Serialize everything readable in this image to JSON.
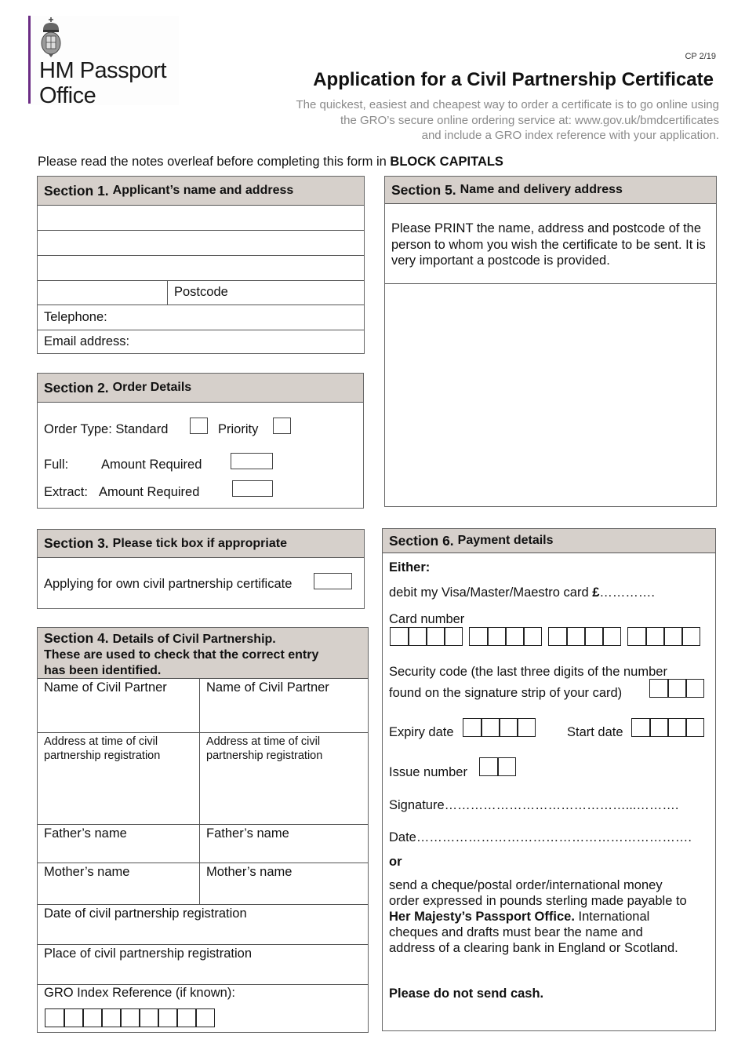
{
  "header": {
    "logo": {
      "line1": "HM Passport",
      "line2": "Office",
      "crest_icon": "royal-crest-icon",
      "brand_color": "#6b2c84"
    },
    "form_code": "CP 2/19",
    "title": "Application for a Civil Partnership Certificate",
    "intro": [
      "The quickest, easiest and cheapest way to order a certificate is to go online using",
      "the GRO’s secure online ordering service at: www.gov.uk/bmdcertificates",
      "and include a GRO index reference with your application."
    ],
    "instruction_prefix": "Please read the notes overleaf before completing this form in ",
    "instruction_bold": "BLOCK CAPITALS"
  },
  "section1": {
    "number": "Section 1.",
    "title": "Applicant’s name and address",
    "postcode_label": "Postcode",
    "telephone_label": "Telephone:",
    "email_label": "Email address:"
  },
  "section2": {
    "number": "Section 2.",
    "title": "Order Details",
    "order_type_label": "Order Type: Standard",
    "priority_label": "Priority",
    "full_label": "Full:",
    "full_amount_label": "Amount Required",
    "extract_label": "Extract:",
    "extract_amount_label": "Amount Required"
  },
  "section3": {
    "number": "Section 3.",
    "title": "Please tick box if appropriate",
    "own_certificate_label": "Applying for own civil partnership certificate"
  },
  "section4": {
    "number": "Section 4.",
    "title_line1": "Details of Civil Partnership.",
    "title_line2": "These are used to check that the correct entry",
    "title_line3": "has been identified.",
    "partner_name_label": "Name of Civil Partner",
    "address_label_line1": "Address at time of civil",
    "address_label_line2": "partnership registration",
    "father_label": "Father’s name",
    "mother_label": "Mother’s name",
    "date_label": "Date of civil partnership registration",
    "place_label": "Place of civil partnership registration",
    "gro_label": "GRO Index Reference (if known):",
    "gro_cells": 9
  },
  "section5": {
    "number": "Section 5.",
    "title": "Name and delivery address",
    "instructions": "Please PRINT the name, address and postcode of the person to whom you wish the certificate to be sent. It is very important a postcode is provided."
  },
  "section6": {
    "number": "Section 6.",
    "title": "Payment details",
    "either": "Either:",
    "debit_label": "debit my Visa/Master/Maestro card ",
    "debit_currency": "£",
    "debit_dots": "………….",
    "card_number_label": "Card number",
    "security_line1": "Security code (the last three digits of the number",
    "security_line2": "found on the signature strip of your card)",
    "expiry_label": "Expiry date",
    "start_label": "Start date",
    "issue_label": "Issue number",
    "signature_label": "Signature……………………………………...……….",
    "date_label": "Date……………………………………………………….",
    "or": "or",
    "cheque_line1": "send a cheque/postal order/international money",
    "cheque_line2": "order expressed in pounds sterling made payable to",
    "cheque_payee": "Her Majesty’s Passport Office.",
    "cheque_line3_rest": " International",
    "cheque_line4": "cheques and drafts must bear the name and",
    "cheque_line5": "address of a clearing bank in England or Scotland.",
    "no_cash": "Please do not send cash."
  }
}
